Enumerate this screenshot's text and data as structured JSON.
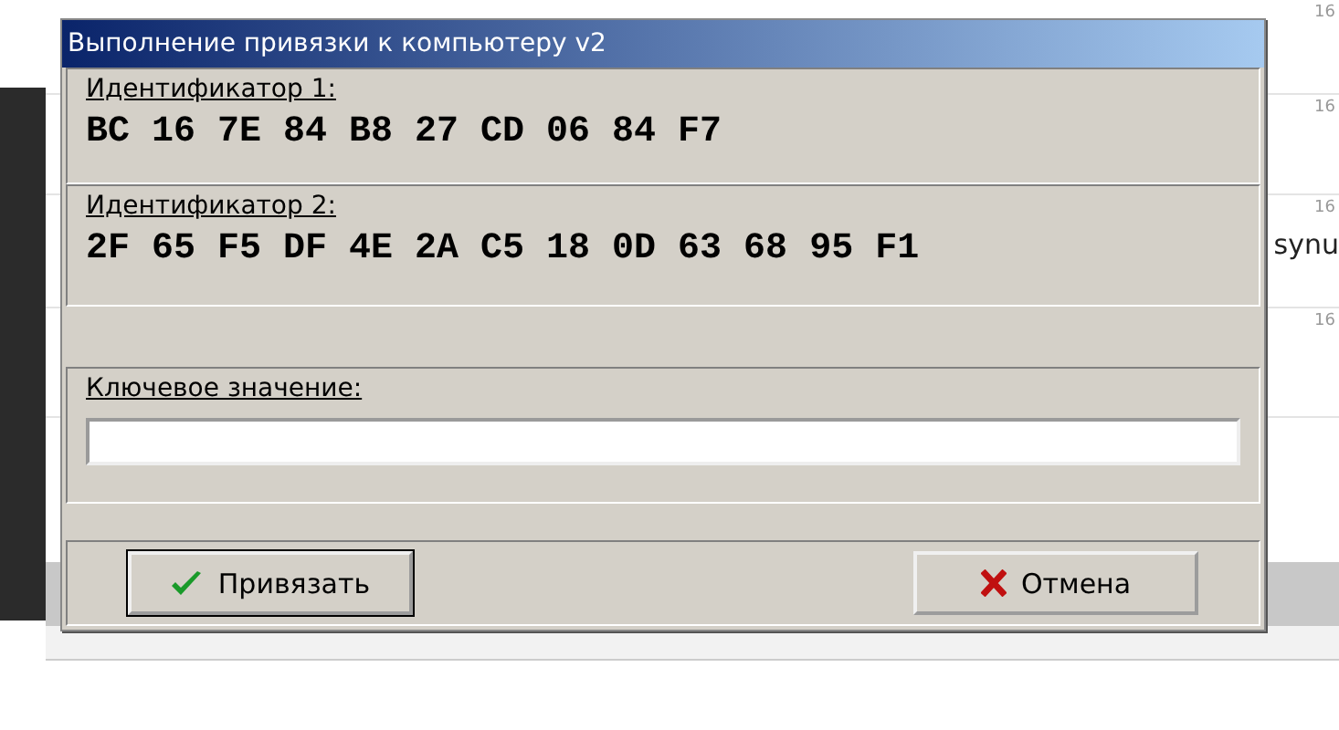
{
  "background": {
    "row_labels": [
      "16",
      "16",
      "16",
      "16"
    ],
    "side_text": "synu"
  },
  "dialog": {
    "title": "Выполнение привязки к компьютеру v2",
    "sections": [
      {
        "label": "Идентификатор 1:",
        "value": "BC 16 7E 84 B8 27 CD 06 84 F7"
      },
      {
        "label": "Идентификатор 2:",
        "value": "2F 65 F5 DF 4E 2A C5 18 0D 63 68 95 F1"
      }
    ],
    "key_field": {
      "label": "Ключевое значение:"
    },
    "buttons": [
      {
        "label": "Привязать",
        "kind": "confirm"
      },
      {
        "label": "Отмена",
        "kind": "cancel"
      }
    ]
  }
}
